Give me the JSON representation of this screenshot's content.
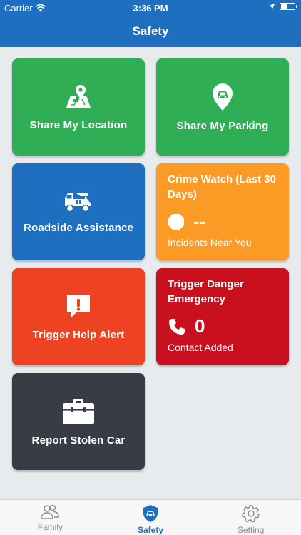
{
  "status": {
    "carrier": "Carrier",
    "time": "3:36 PM",
    "battery_level": 0.55
  },
  "nav": {
    "title": "Safety"
  },
  "tiles": {
    "share_location": {
      "label": "Share My Location",
      "icon": "map-pin-icon",
      "color": "#2fae55"
    },
    "share_parking": {
      "label": "Share My Parking",
      "icon": "car-pin-icon",
      "color": "#2fae55"
    },
    "roadside": {
      "label": "Roadside Assistance",
      "icon": "tow-truck-icon",
      "color": "#1f6fc1"
    },
    "crime_watch": {
      "title": "Crime Watch (Last 30 Days)",
      "value": "--",
      "subtitle": "Incidents Near You",
      "icon": "octagon-icon",
      "color": "#fb9a24"
    },
    "help_alert": {
      "label": "Trigger Help Alert",
      "icon": "alert-bubble-icon",
      "color": "#ee4322"
    },
    "danger": {
      "title": "Trigger Danger Emergency",
      "value": "0",
      "subtitle": "Contact Added",
      "icon": "phone-icon",
      "color": "#c8101e"
    },
    "stolen_car": {
      "label": "Report Stolen Car",
      "icon": "briefcase-icon",
      "color": "#383c45"
    }
  },
  "tabbar": {
    "tabs": [
      {
        "label": "Family",
        "icon": "family-icon",
        "active": false
      },
      {
        "label": "Safety",
        "icon": "shield-car-icon",
        "active": true
      },
      {
        "label": "Setting",
        "icon": "gear-icon",
        "active": false
      }
    ]
  }
}
